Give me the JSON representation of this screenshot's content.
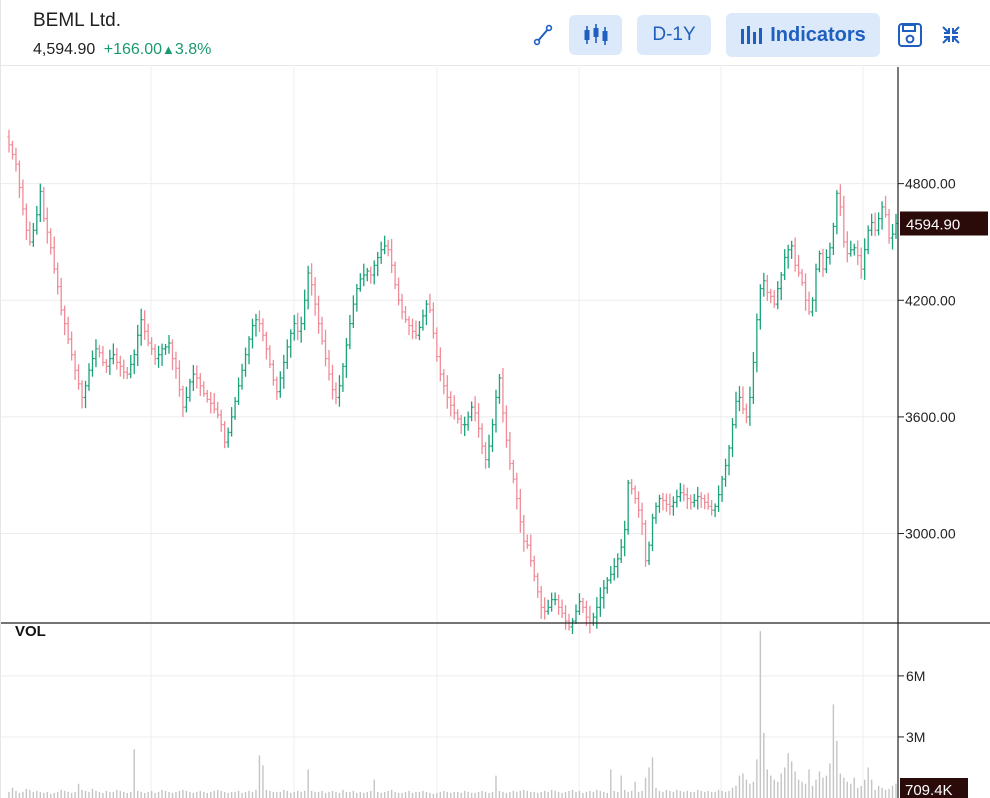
{
  "header": {
    "title": "BEML Ltd.",
    "last_price": "4,594.90",
    "change": "+166.00",
    "change_arrow": "▲",
    "change_pct": "3.8%",
    "up_color": "#1a9a6c"
  },
  "toolbar": {
    "draw_icon": "trendline-icon",
    "chart_type_icon": "candlestick-icon",
    "range_label": "D-1Y",
    "indicators_label": "Indicators",
    "save_icon": "save-icon",
    "collapse_icon": "collapse-icon",
    "accent": "#1f5fbf",
    "button_bg": "#dce9fb"
  },
  "chart_data": {
    "type": "ohlc",
    "interval": "D",
    "range": "1Y",
    "price_axis": {
      "ticks": [
        "4800.00",
        "4200.00",
        "3600.00",
        "3000.00"
      ],
      "tick_values": [
        4800,
        4200,
        3600,
        3000
      ],
      "ylim": [
        2550,
        5400
      ]
    },
    "last_price_tag": "4594.90",
    "last_price_value": 4594.9,
    "volume_pane": {
      "label": "VOL",
      "ticks": [
        "6M",
        "3M"
      ],
      "tick_values": [
        6000000,
        3000000
      ],
      "ylim": [
        0,
        8500000
      ],
      "last_volume_tag": "709.4K"
    },
    "colors": {
      "up": "#1aa37a",
      "down": "#f08b97",
      "volume": "#c4c4c4",
      "tag_bg": "#2b0a0a"
    },
    "grid": true,
    "closes": [
      5000,
      4950,
      4900,
      4780,
      4670,
      4560,
      4500,
      4560,
      4640,
      4760,
      4620,
      4550,
      4470,
      4360,
      4270,
      4150,
      4080,
      4000,
      3920,
      3840,
      3770,
      3700,
      3760,
      3840,
      3900,
      3950,
      3930,
      3880,
      3860,
      3900,
      3920,
      3880,
      3860,
      3830,
      3820,
      3870,
      3920,
      4020,
      4100,
      4040,
      3980,
      3950,
      3900,
      3920,
      3950,
      3960,
      3980,
      3900,
      3850,
      3740,
      3650,
      3700,
      3780,
      3820,
      3800,
      3760,
      3720,
      3690,
      3670,
      3640,
      3610,
      3560,
      3470,
      3520,
      3600,
      3680,
      3760,
      3840,
      3920,
      4000,
      4070,
      4100,
      4080,
      4020,
      3950,
      3870,
      3790,
      3730,
      3800,
      3880,
      3960,
      4030,
      4080,
      4040,
      4080,
      4200,
      4340,
      4280,
      4180,
      4080,
      3990,
      3900,
      3820,
      3740,
      3700,
      3760,
      3860,
      3970,
      4080,
      4180,
      4260,
      4310,
      4330,
      4350,
      4330,
      4380,
      4420,
      4460,
      4480,
      4460,
      4380,
      4280,
      4200,
      4140,
      4100,
      4070,
      4040,
      4020,
      4060,
      4120,
      4180,
      4150,
      4030,
      3910,
      3820,
      3760,
      3700,
      3660,
      3620,
      3590,
      3560,
      3560,
      3600,
      3650,
      3620,
      3540,
      3450,
      3380,
      3450,
      3560,
      3700,
      3800,
      3620,
      3480,
      3360,
      3280,
      3180,
      3060,
      2960,
      2940,
      2860,
      2780,
      2700,
      2620,
      2600,
      2620,
      2660,
      2660,
      2620,
      2590,
      2550,
      2520,
      2550,
      2600,
      2650,
      2620,
      2570,
      2540,
      2570,
      2620,
      2670,
      2720,
      2760,
      2790,
      2830,
      2870,
      2930,
      3020,
      3260,
      3230,
      3180,
      3120,
      3050,
      2860,
      2940,
      3080,
      3140,
      3180,
      3170,
      3150,
      3140,
      3160,
      3190,
      3210,
      3200,
      3180,
      3160,
      3170,
      3190,
      3180,
      3160,
      3140,
      3120,
      3140,
      3200,
      3280,
      3350,
      3440,
      3560,
      3680,
      3700,
      3640,
      3600,
      3700,
      3880,
      4100,
      4260,
      4300,
      4240,
      4220,
      4180,
      4260,
      4330,
      4420,
      4460,
      4480,
      4380,
      4340,
      4290,
      4200,
      4140,
      4200,
      4360,
      4440,
      4360,
      4420,
      4470,
      4580,
      4750,
      4680,
      4500,
      4440,
      4460,
      4470,
      4430,
      4360,
      4460,
      4560,
      4600,
      4560,
      4620,
      4680,
      4640,
      4520,
      4540,
      4594.9
    ],
    "volumes": [
      300000,
      500000,
      350000,
      250000,
      300000,
      450000,
      400000,
      300000,
      350000,
      300000,
      250000,
      300000,
      200000,
      250000,
      300000,
      400000,
      350000,
      300000,
      250000,
      300000,
      700000,
      400000,
      350000,
      300000,
      450000,
      350000,
      300000,
      250000,
      350000,
      300000,
      300000,
      400000,
      350000,
      300000,
      250000,
      300000,
      2400000,
      350000,
      300000,
      250000,
      300000,
      350000,
      250000,
      300000,
      400000,
      350000,
      300000,
      250000,
      300000,
      350000,
      400000,
      350000,
      300000,
      250000,
      300000,
      350000,
      300000,
      250000,
      300000,
      350000,
      400000,
      350000,
      300000,
      250000,
      300000,
      300000,
      350000,
      250000,
      300000,
      350000,
      300000,
      400000,
      2100000,
      1600000,
      400000,
      350000,
      300000,
      300000,
      300000,
      400000,
      350000,
      250000,
      300000,
      350000,
      300000,
      350000,
      1400000,
      350000,
      300000,
      300000,
      350000,
      250000,
      300000,
      350000,
      300000,
      250000,
      400000,
      300000,
      300000,
      350000,
      250000,
      300000,
      250000,
      300000,
      350000,
      900000,
      300000,
      250000,
      300000,
      350000,
      400000,
      300000,
      250000,
      250000,
      300000,
      350000,
      250000,
      300000,
      300000,
      350000,
      300000,
      250000,
      200000,
      250000,
      300000,
      350000,
      300000,
      250000,
      300000,
      300000,
      250000,
      350000,
      300000,
      250000,
      250000,
      300000,
      350000,
      300000,
      250000,
      300000,
      1100000,
      350000,
      300000,
      250000,
      300000,
      350000,
      300000,
      350000,
      400000,
      350000,
      300000,
      300000,
      250000,
      300000,
      350000,
      300000,
      400000,
      350000,
      300000,
      250000,
      300000,
      350000,
      400000,
      300000,
      350000,
      250000,
      300000,
      350000,
      300000,
      400000,
      350000,
      300000,
      250000,
      1400000,
      350000,
      300000,
      1100000,
      400000,
      300000,
      350000,
      800000,
      300000,
      350000,
      1000000,
      1500000,
      2000000,
      500000,
      350000,
      300000,
      400000,
      350000,
      300000,
      400000,
      350000,
      300000,
      350000,
      300000,
      300000,
      400000,
      350000,
      300000,
      350000,
      300000,
      300000,
      400000,
      350000,
      300000,
      350000,
      500000,
      600000,
      1100000,
      1200000,
      900000,
      700000,
      800000,
      1900000,
      8200000,
      3200000,
      1400000,
      1100000,
      900000,
      800000,
      1200000,
      1500000,
      2200000,
      1800000,
      1300000,
      900000,
      800000,
      700000,
      1400000,
      600000,
      900000,
      1300000,
      1000000,
      1100000,
      1700000,
      4600000,
      2800000,
      1200000,
      1000000,
      800000,
      700000,
      1000000,
      500000,
      600000,
      900000,
      1500000,
      900000,
      400000,
      600000,
      500000,
      400000,
      450000,
      600000,
      709400
    ]
  }
}
